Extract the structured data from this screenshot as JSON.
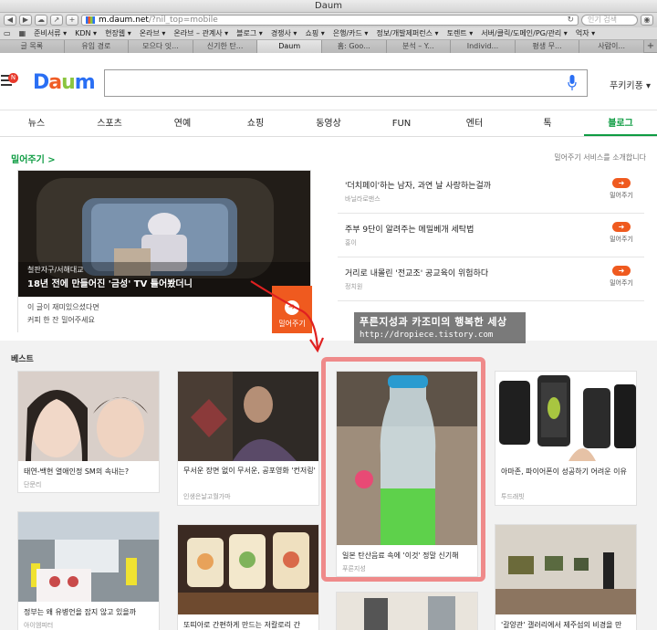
{
  "window": {
    "title": "Daum"
  },
  "toolbar": {
    "back": "◀",
    "forward": "▶",
    "cloud": "☁",
    "share": "↗",
    "new_tab": "+",
    "url_domain": "m.daum.net",
    "url_rest": "/?nil_top=mobile",
    "reload": "↻",
    "search_placeholder": "인기 검색",
    "profile": "◉"
  },
  "bookmarks": [
    "▭",
    "▦",
    "준비서류 ▾",
    "KDN ▾",
    "현장웹 ▾",
    "온라브 ▾",
    "온라브 – 관계사 ▾",
    "블로그 ▾",
    "경쟁사 ▾",
    "쇼핑 ▾",
    "은행/카드 ▾",
    "정보/개발제퍼런스 ▾",
    "토렌트 ▾",
    "서버/클릭/도메인/PG/관리 ▾",
    "억자 ▾"
  ],
  "tabs": [
    {
      "label": "글 목록",
      "active": false
    },
    {
      "label": "유입 경로",
      "active": false
    },
    {
      "label": "모으다 잇...",
      "active": false
    },
    {
      "label": "신기한 탄...",
      "active": false
    },
    {
      "label": "Daum",
      "active": true
    },
    {
      "label": "홈: Goo...",
      "active": false
    },
    {
      "label": "분석 – Y...",
      "active": false
    },
    {
      "label": "Individ...",
      "active": false
    },
    {
      "label": "평생 무...",
      "active": false
    },
    {
      "label": "사람이...",
      "active": false
    }
  ],
  "header": {
    "menu_badge": "N",
    "logo": {
      "d": "D",
      "a": "a",
      "u": "u",
      "m": "m"
    },
    "user": "푸키키퐁 ▾"
  },
  "nav": [
    {
      "label": "뉴스",
      "active": false
    },
    {
      "label": "스포츠",
      "active": false
    },
    {
      "label": "연예",
      "active": false
    },
    {
      "label": "쇼핑",
      "active": false
    },
    {
      "label": "동영상",
      "active": false
    },
    {
      "label": "FUN",
      "active": false
    },
    {
      "label": "엔터",
      "active": false
    },
    {
      "label": "톡",
      "active": false
    },
    {
      "label": "블로그",
      "active": true
    }
  ],
  "push": {
    "title": "밀어주기 >",
    "desc": "밀어주기 서비스를 소개합니다",
    "feature": {
      "caption_small": "철판자구/서해대교",
      "caption": "18년 전에 만들어진 '금성' TV 틀어봤더니",
      "line1": "이 글이 재미있으셨다면",
      "line2": "커피 한 잔 밀어주세요",
      "button": "밀어주기",
      "button_icon": "➜"
    },
    "items": [
      {
        "title": "'더치페이'하는 남자, 과연 날 사랑하는걸까",
        "source": "바닐라로맨스",
        "button": "밀어주기",
        "icon": "➜"
      },
      {
        "title": "주부 9단이 알려주는 메밀베개 세탁법",
        "source": "홍이",
        "button": "밀어주기",
        "icon": "➜"
      },
      {
        "title": "거리로 내몰린 '전교조' 공교육이 위험하다",
        "source": "정치원",
        "button": "밀어주기",
        "icon": "➜"
      }
    ]
  },
  "watermark": {
    "title": "푸른지성과 카조미의 행복한 세상",
    "url": "http://dropiece.tistory.com"
  },
  "best": {
    "title": "베스트",
    "cards": [
      {
        "title": "태연-백현 열애인정 SM의 속내는?",
        "source": "단문리"
      },
      {
        "title": "무서운 장면 없이 무서운, 공포영화 '컨저링'",
        "source": "인생은날고월가마"
      },
      {
        "title": "일본 탄산음료 속에 '이것' 정말 신기해",
        "source": "푸른지성"
      },
      {
        "title": "아마존, 파이어폰이 성공하기 어려운 이유",
        "source": "투드래빗"
      },
      {
        "title": "정부는 왜 유병언을 잡지 않고 있을까",
        "source": "아이엠피터"
      },
      {
        "title": "또띠아로 간편하게 만드는 저칼로리 간",
        "source": ""
      },
      {
        "title": "",
        "source": ""
      },
      {
        "title": "'갈양관' 갤러리에서 제주섬의 비경을 만",
        "source": ""
      }
    ]
  },
  "colors": {
    "daum_green": "#0e9c43",
    "push_orange": "#ef5a1f",
    "highlight": "#ee7878"
  }
}
